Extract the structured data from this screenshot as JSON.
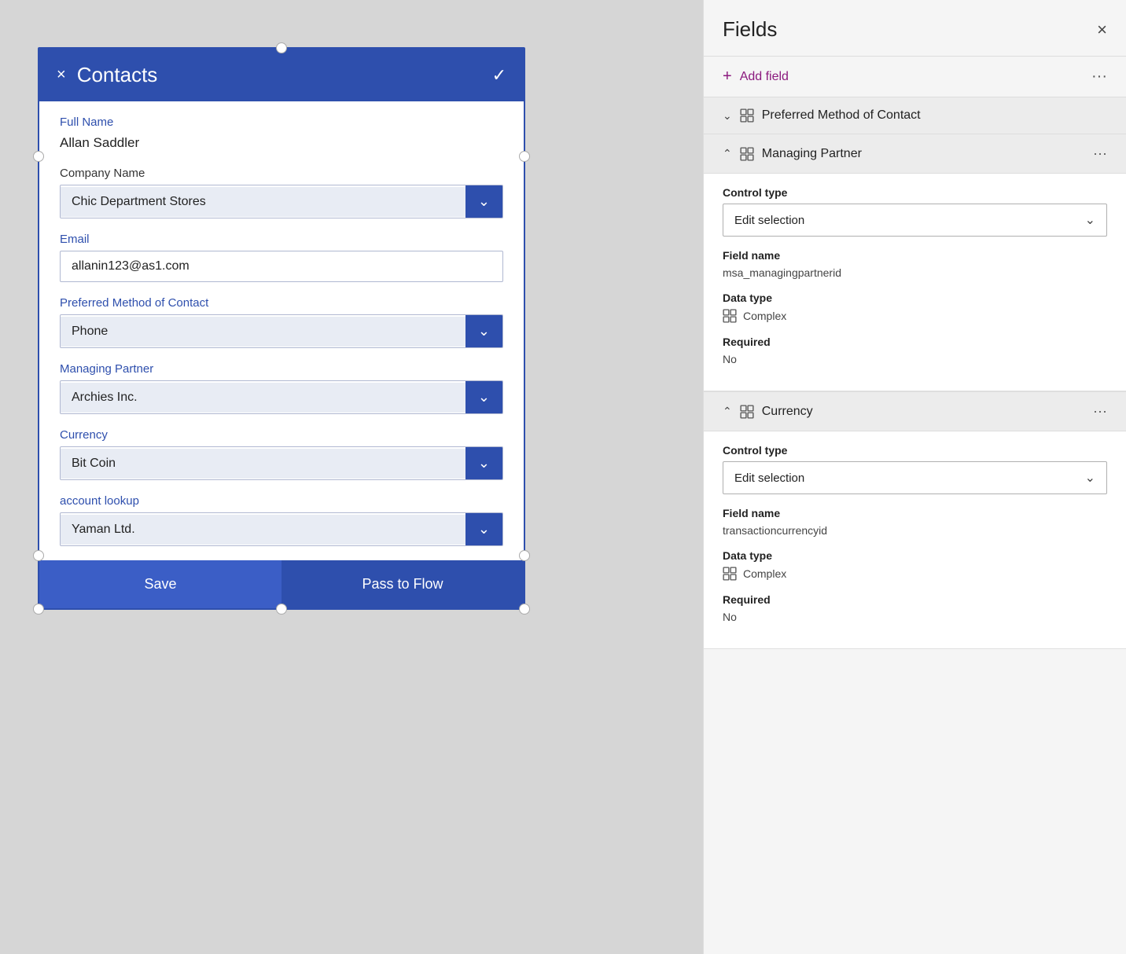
{
  "contacts": {
    "title": "Contacts",
    "close_icon": "×",
    "check_icon": "✓",
    "fields": {
      "full_name_label": "Full Name",
      "full_name_value": "Allan Saddler",
      "company_name_label": "Company Name",
      "company_name_value": "Chic Department Stores",
      "email_label": "Email",
      "email_value": "allanin123@as1.com",
      "preferred_contact_label": "Preferred Method of Contact",
      "preferred_contact_value": "Phone",
      "managing_partner_label": "Managing Partner",
      "managing_partner_value": "Archies Inc.",
      "currency_label": "Currency",
      "currency_value": "Bit Coin",
      "account_lookup_label": "account lookup",
      "account_lookup_value": "Yaman Ltd."
    },
    "save_label": "Save",
    "pass_to_flow_label": "Pass to Flow"
  },
  "fields_panel": {
    "title": "Fields",
    "close_icon": "×",
    "add_field_label": "Add field",
    "more_icon": "···",
    "sections": [
      {
        "id": "preferred_contact",
        "chevron": "∨",
        "label": "Preferred Method of Contact",
        "expanded": false
      },
      {
        "id": "managing_partner",
        "chevron": "∧",
        "label": "Managing Partner",
        "expanded": true,
        "control_type_label": "Control type",
        "control_type_value": "Edit selection",
        "field_name_label": "Field name",
        "field_name_value": "msa_managingpartnerid",
        "data_type_label": "Data type",
        "data_type_value": "Complex",
        "required_label": "Required",
        "required_value": "No"
      },
      {
        "id": "currency",
        "chevron": "∧",
        "label": "Currency",
        "expanded": true,
        "control_type_label": "Control type",
        "control_type_value": "Edit selection",
        "field_name_label": "Field name",
        "field_name_value": "transactioncurrencyid",
        "data_type_label": "Data type",
        "data_type_value": "Complex",
        "required_label": "Required",
        "required_value": "No"
      }
    ]
  }
}
